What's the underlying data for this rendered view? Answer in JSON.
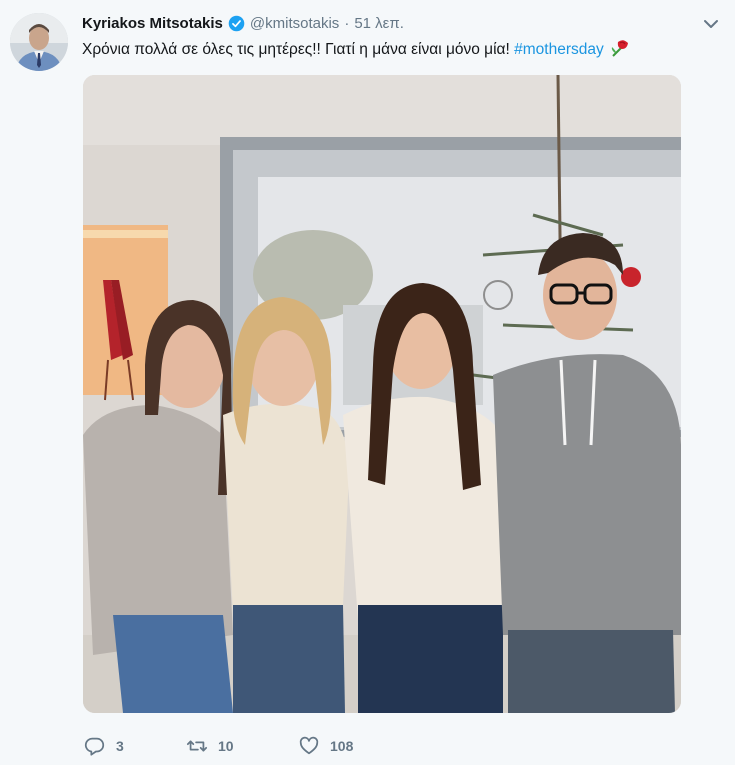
{
  "tweet": {
    "author_name": "Kyriakos Mitsotakis",
    "handle": "@kmitsotakis",
    "separator": "·",
    "time": "51 λεπ.",
    "text": "Χρόνια πολλά σε όλες τις μητέρες!! Γιατί η μάνα είναι μόνο μία! ",
    "hashtag": "#mothersday",
    "emoji": "rose-emoji"
  },
  "icons": {
    "verified": "verified-badge-icon",
    "menu": "chevron-down-icon",
    "reply": "reply-icon",
    "retweet": "retweet-icon",
    "like": "heart-icon"
  },
  "actions": {
    "reply_count": "3",
    "retweet_count": "10",
    "like_count": "108"
  },
  "colors": {
    "background": "#f5f8fa",
    "text": "#14171a",
    "secondary": "#657786",
    "link": "#1b95e0",
    "verified": "#1da1f2"
  }
}
